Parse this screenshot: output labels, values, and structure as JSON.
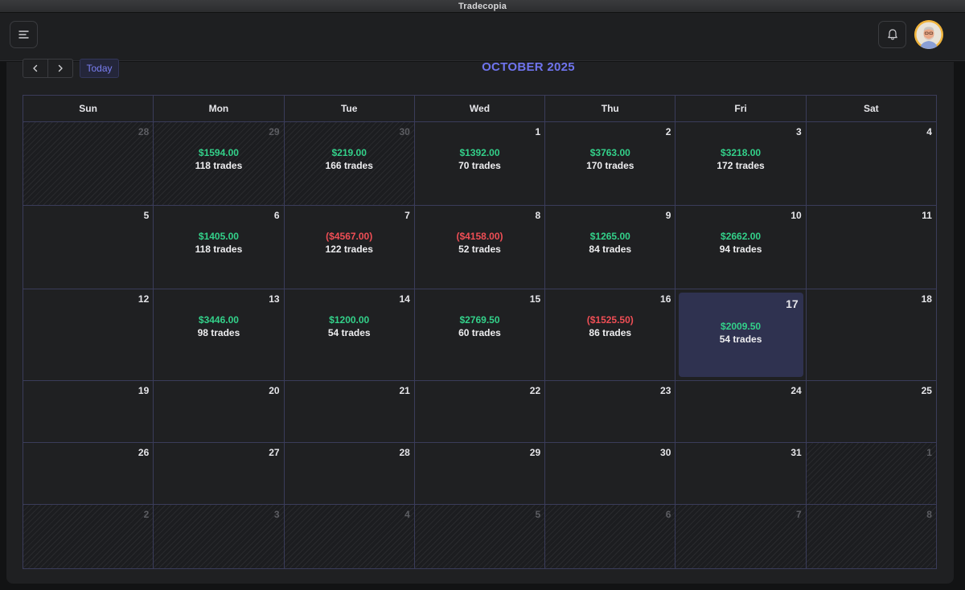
{
  "app": {
    "title": "Tradecopia"
  },
  "topbar": {
    "menu_icon": "menu-icon",
    "bell_icon": "bell-icon",
    "avatar": "user-avatar"
  },
  "toolbar": {
    "prev_icon": "chevron-left-icon",
    "next_icon": "chevron-right-icon",
    "today_label": "Today",
    "month_title": "OCTOBER 2025"
  },
  "colors": {
    "accent": "#6f74ee",
    "profit": "#33d18a",
    "loss": "#ef4e55",
    "today_highlight": "#2f3250"
  },
  "weekdays": [
    "Sun",
    "Mon",
    "Tue",
    "Wed",
    "Thu",
    "Fri",
    "Sat"
  ],
  "weeks": [
    [
      {
        "day": "28",
        "outside": true
      },
      {
        "day": "29",
        "outside": true,
        "pnl": "$1594.00",
        "trades": "118 trades",
        "sign": "pos"
      },
      {
        "day": "30",
        "outside": true,
        "pnl": "$219.00",
        "trades": "166 trades",
        "sign": "pos"
      },
      {
        "day": "1",
        "pnl": "$1392.00",
        "trades": "70 trades",
        "sign": "pos"
      },
      {
        "day": "2",
        "pnl": "$3763.00",
        "trades": "170 trades",
        "sign": "pos"
      },
      {
        "day": "3",
        "pnl": "$3218.00",
        "trades": "172 trades",
        "sign": "pos"
      },
      {
        "day": "4"
      }
    ],
    [
      {
        "day": "5"
      },
      {
        "day": "6",
        "pnl": "$1405.00",
        "trades": "118 trades",
        "sign": "pos"
      },
      {
        "day": "7",
        "pnl": "($4567.00)",
        "trades": "122 trades",
        "sign": "neg"
      },
      {
        "day": "8",
        "pnl": "($4158.00)",
        "trades": "52 trades",
        "sign": "neg"
      },
      {
        "day": "9",
        "pnl": "$1265.00",
        "trades": "84 trades",
        "sign": "pos"
      },
      {
        "day": "10",
        "pnl": "$2662.00",
        "trades": "94 trades",
        "sign": "pos"
      },
      {
        "day": "11"
      }
    ],
    [
      {
        "day": "12"
      },
      {
        "day": "13",
        "pnl": "$3446.00",
        "trades": "98 trades",
        "sign": "pos"
      },
      {
        "day": "14",
        "pnl": "$1200.00",
        "trades": "54 trades",
        "sign": "pos"
      },
      {
        "day": "15",
        "pnl": "$2769.50",
        "trades": "60 trades",
        "sign": "pos"
      },
      {
        "day": "16",
        "pnl": "($1525.50)",
        "trades": "86 trades",
        "sign": "neg"
      },
      {
        "day": "17",
        "today": true,
        "pnl": "$2009.50",
        "trades": "54 trades",
        "sign": "pos"
      },
      {
        "day": "18"
      }
    ],
    [
      {
        "day": "19"
      },
      {
        "day": "20"
      },
      {
        "day": "21"
      },
      {
        "day": "22"
      },
      {
        "day": "23"
      },
      {
        "day": "24"
      },
      {
        "day": "25"
      }
    ],
    [
      {
        "day": "26"
      },
      {
        "day": "27"
      },
      {
        "day": "28"
      },
      {
        "day": "29"
      },
      {
        "day": "30"
      },
      {
        "day": "31"
      },
      {
        "day": "1",
        "outside": true
      }
    ],
    [
      {
        "day": "2",
        "outside": true
      },
      {
        "day": "3",
        "outside": true
      },
      {
        "day": "4",
        "outside": true
      },
      {
        "day": "5",
        "outside": true
      },
      {
        "day": "6",
        "outside": true
      },
      {
        "day": "7",
        "outside": true
      },
      {
        "day": "8",
        "outside": true
      }
    ]
  ]
}
